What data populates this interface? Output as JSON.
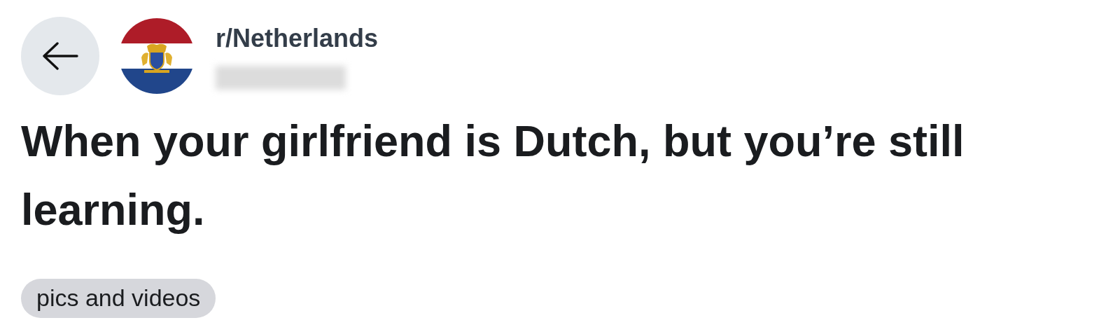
{
  "header": {
    "community": "r/Netherlands"
  },
  "post": {
    "title": "When your girlfriend is Dutch, but you’re still learning.",
    "flair": "pics and videos"
  }
}
